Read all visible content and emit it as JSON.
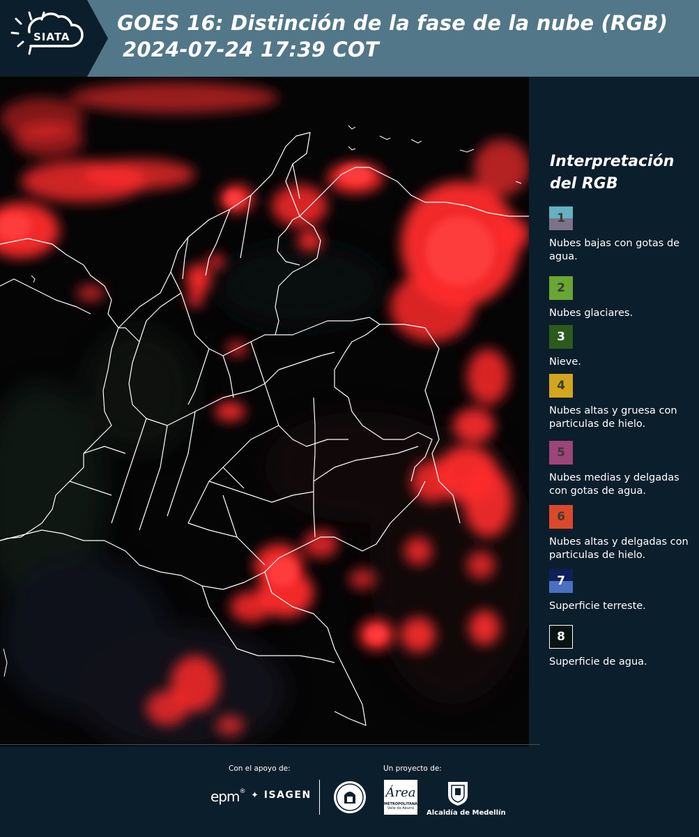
{
  "header": {
    "logo_text": "SIATA",
    "title": "GOES 16: Distinción de la fase de la nube (RGB)",
    "timestamp": "2024-07-24 17:39 COT"
  },
  "legend": {
    "title": "Interpretación del RGB",
    "items": [
      {
        "number": "1",
        "label": "Nubes bajas con gotas de agua.",
        "colors": [
          "#63b1c1",
          "#7c7389"
        ]
      },
      {
        "number": "2",
        "label": "Nubes glaciares.",
        "colors": [
          "#6aa631"
        ]
      },
      {
        "number": "3",
        "label": "Nieve.",
        "colors": [
          "#2c5a1d"
        ]
      },
      {
        "number": "4",
        "label": "Nubes altas y gruesa con particulas de hielo.",
        "colors": [
          "#d3a61d"
        ]
      },
      {
        "number": "5",
        "label": "Nubes medias y delgadas con gotas de agua.",
        "colors": [
          "#9d4478"
        ]
      },
      {
        "number": "6",
        "label": "Nubes altas y delgadas con particulas de hielo.",
        "colors": [
          "#db492b"
        ]
      },
      {
        "number": "7",
        "label": "Superficie terreste.",
        "colors": [
          "#0f1f5a",
          "#4b70c0"
        ]
      },
      {
        "number": "8",
        "label": "Superficie de agua.",
        "colors": [
          "#071412"
        ]
      }
    ]
  },
  "footer": {
    "support_label": "Con el apoyo de:",
    "project_label": "Un proyecto de:",
    "sponsors": [
      "epm",
      "ISAGEN"
    ],
    "partners": [
      "Área Metropolitana Valle de Aburrá",
      "Alcaldía de Medellín"
    ],
    "partner_small_text": "METROPOLITANA",
    "partner_small_sub": "Valle de Aburrá",
    "alcaldia_label": "Alcaldía de Medellín"
  },
  "map": {
    "region": "Colombia",
    "cloud_color": "#ff2c2c",
    "background_color": "#050506",
    "border_color": "#ffffff"
  }
}
